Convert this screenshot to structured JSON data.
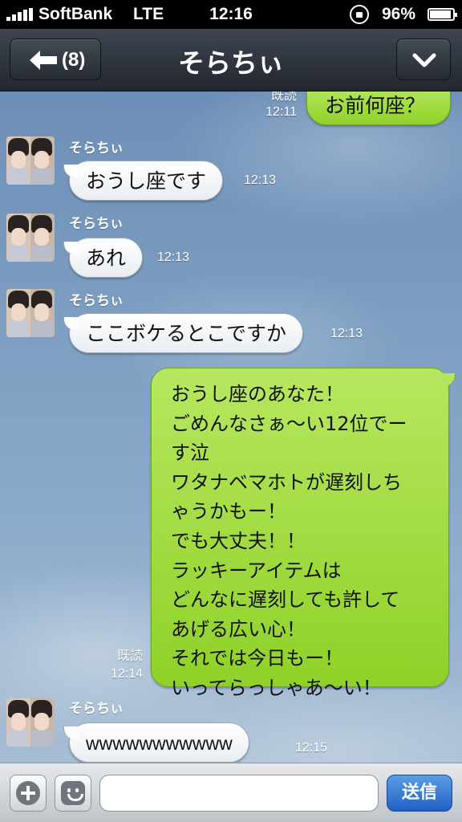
{
  "status_bar": {
    "carrier": "SoftBank",
    "network": "LTE",
    "time": "12:16",
    "battery": "96%"
  },
  "nav": {
    "back_count": "(8)",
    "title": "そらちぃ"
  },
  "messages": [
    {
      "side": "out",
      "text": "お前何座？",
      "read": "既読",
      "time": "12:11"
    },
    {
      "side": "in",
      "sender": "そらちぃ",
      "text": "おうし座です",
      "time": "12:13"
    },
    {
      "side": "in",
      "sender": "そらちぃ",
      "text": "あれ",
      "time": "12:13"
    },
    {
      "side": "in",
      "sender": "そらちぃ",
      "text": "ここボケるとこですか",
      "time": "12:13"
    },
    {
      "side": "out",
      "text": "おうし座のあなた！\nごめんなさぁ〜い12位でー\nす泣\nワタナベマホトが遅刻しち\nゃうかもー！\nでも大丈夫！！\nラッキーアイテムは\nどんなに遅刻しても許して\nあげる広い心！\nそれでは今日もー！\nいってらっしゃあ〜い！",
      "read": "既読",
      "time": "12:14"
    },
    {
      "side": "in",
      "sender": "そらちぃ",
      "text": "wwwwwwwwwww",
      "time": "12:15"
    }
  ],
  "input": {
    "value": "",
    "send_label": "送信"
  },
  "icons": {
    "back": "back-arrow-icon",
    "menu": "chevron-down-icon",
    "attach": "plus-icon",
    "sticker": "smiley-icon"
  },
  "colors": {
    "outgoing_bubble": "#a4dd45",
    "incoming_bubble": "#ffffff",
    "send_button": "#2f73d6",
    "nav_bar": "#2d333b"
  }
}
